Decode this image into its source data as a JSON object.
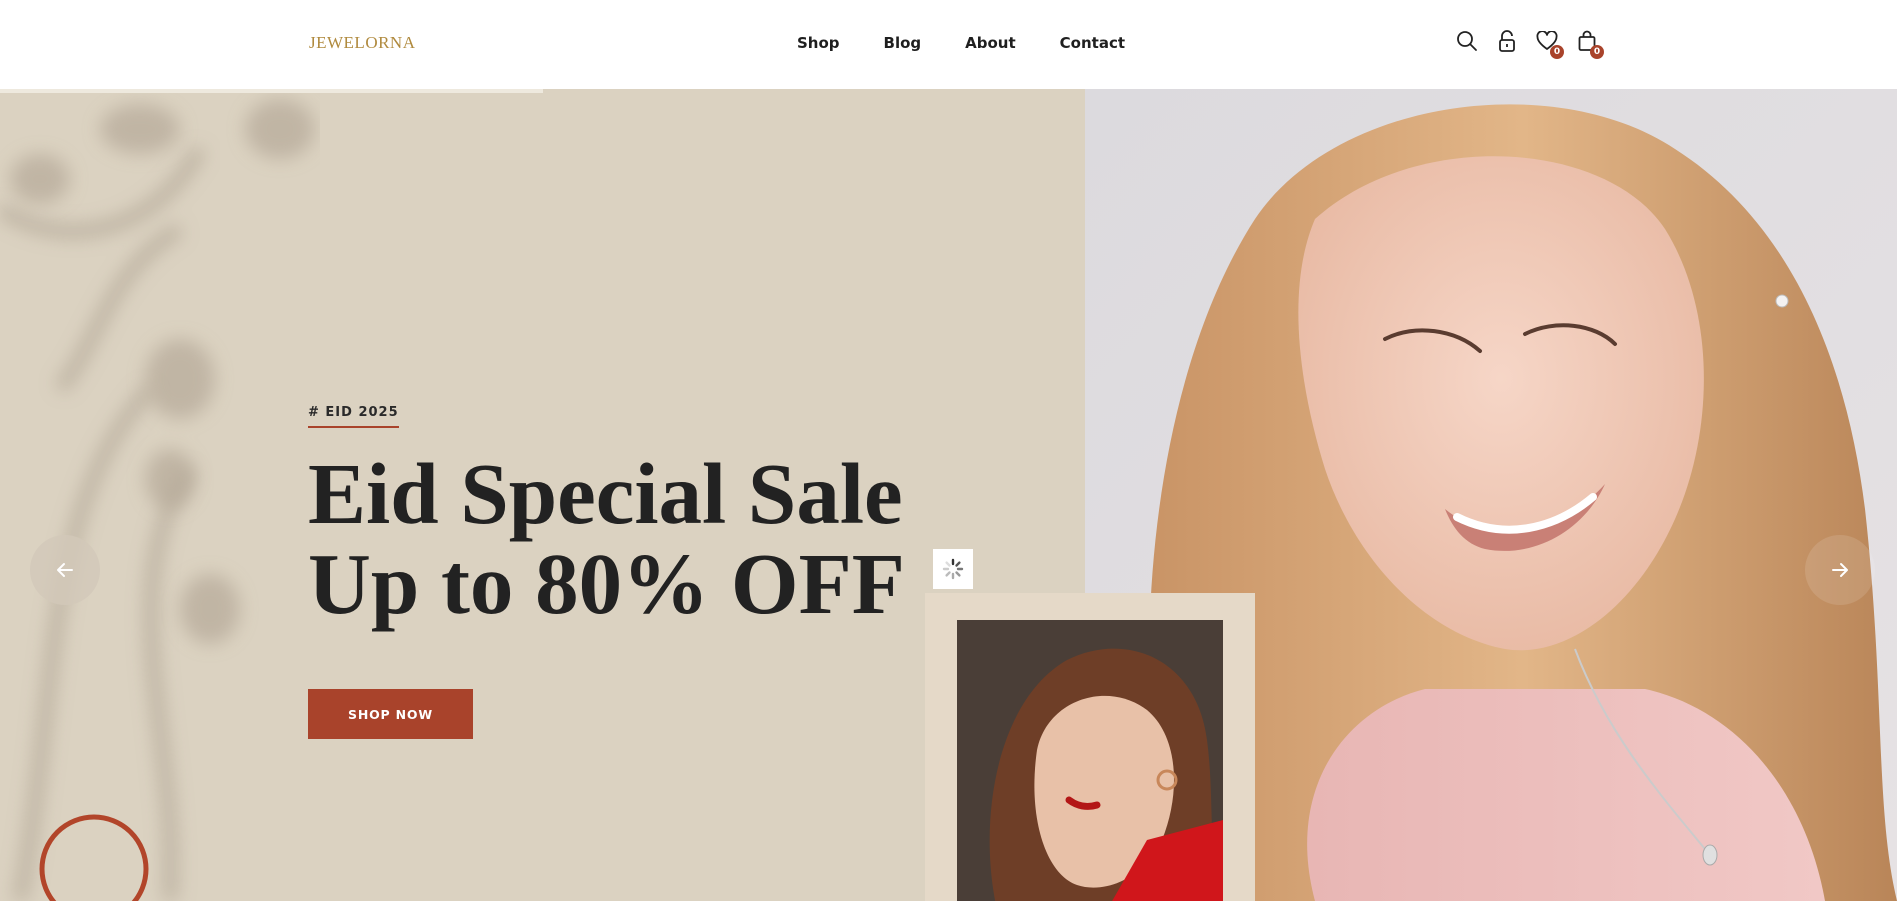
{
  "header": {
    "logo": "JEWELORNA",
    "nav": [
      "Shop",
      "Blog",
      "About",
      "Contact"
    ],
    "icons": {
      "search": "search-icon",
      "account": "lock-icon",
      "wishlist": "heart-icon",
      "cart": "bag-icon"
    },
    "wishlist_count": "0",
    "cart_count": "0"
  },
  "slider": {
    "progress": 0.286
  },
  "hero": {
    "tag": "# EID 2025",
    "headline_line1": "Eid Special Sale",
    "headline_line2": "Up to 80% OFF",
    "cta": "SHOP NOW",
    "prev_icon": "arrow-left-icon",
    "next_icon": "arrow-right-icon",
    "loader_icon": "spinner-icon"
  },
  "colors": {
    "accent": "#a9432b",
    "hero_bg": "#dbd2c1",
    "logo": "#b08a3e",
    "text": "#222222"
  }
}
